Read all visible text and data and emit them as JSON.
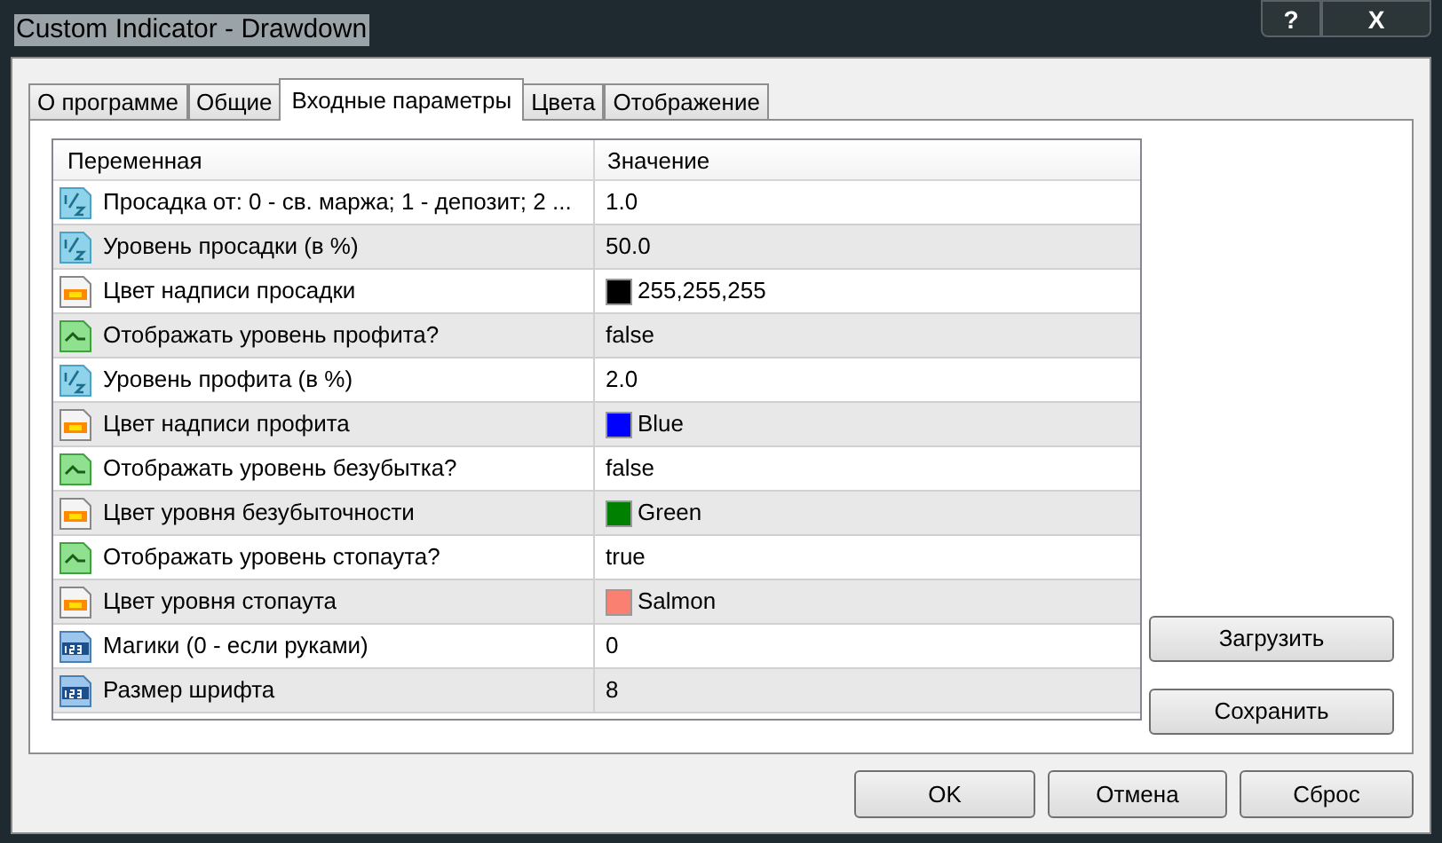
{
  "window": {
    "title": "Custom Indicator - Drawdown",
    "buttons": [
      "?",
      "X"
    ]
  },
  "tabs": [
    {
      "label": "О программе",
      "selected": false
    },
    {
      "label": "Общие",
      "selected": false
    },
    {
      "label": "Входные параметры",
      "selected": true
    },
    {
      "label": "Цвета",
      "selected": false
    },
    {
      "label": "Отображение",
      "selected": false
    }
  ],
  "table": {
    "columns": [
      "Переменная",
      "Значение"
    ],
    "rows": [
      {
        "kind": "fraction",
        "name": "Просадка от: 0 - св. маржа; 1 - депозит; 2 ...",
        "value": "1.0"
      },
      {
        "kind": "fraction",
        "name": "Уровень просадки (в %)",
        "value": "50.0"
      },
      {
        "kind": "color",
        "name": "Цвет надписи просадки",
        "value": "255,255,255",
        "color": "#000000"
      },
      {
        "kind": "bool",
        "name": "Отображать уровень профита?",
        "value": "false"
      },
      {
        "kind": "fraction",
        "name": "Уровень профита (в %)",
        "value": "2.0"
      },
      {
        "kind": "color",
        "name": "Цвет надписи профита",
        "value": "Blue",
        "color": "#0000ff"
      },
      {
        "kind": "bool",
        "name": "Отображать уровень безубытка?",
        "value": "false"
      },
      {
        "kind": "color",
        "name": "Цвет уровня безубыточности",
        "value": "Green",
        "color": "#008000"
      },
      {
        "kind": "bool",
        "name": "Отображать уровень стопаута?",
        "value": "true"
      },
      {
        "kind": "color",
        "name": "Цвет уровня стопаута",
        "value": "Salmon",
        "color": "#fa8072"
      },
      {
        "kind": "integer",
        "name": "Магики (0 - если руками)",
        "value": "0"
      },
      {
        "kind": "integer",
        "name": "Размер шрифта",
        "value": "8"
      }
    ]
  },
  "side_buttons": [
    "Загрузить",
    "Сохранить"
  ],
  "footer_buttons": [
    "OK",
    "Отмена",
    "Сброс"
  ]
}
